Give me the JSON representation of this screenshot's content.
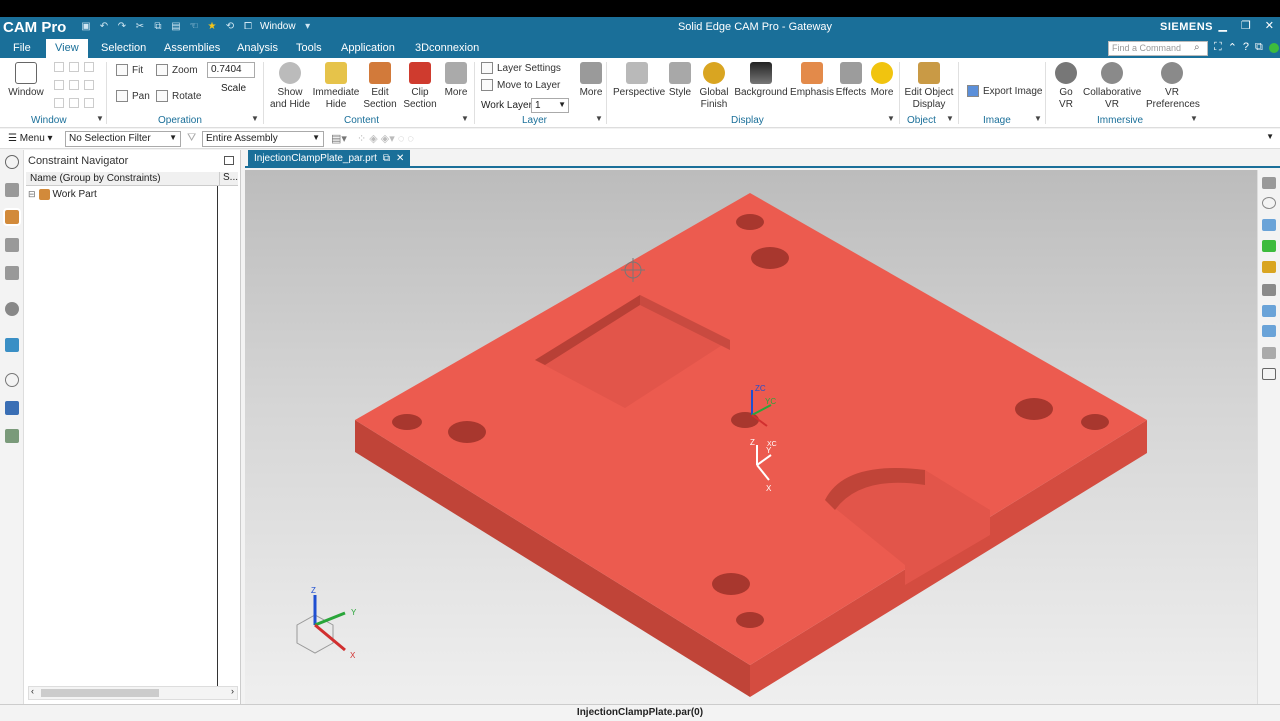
{
  "app": {
    "name": "CAM Pro",
    "window_menu_label": "Window",
    "title": "Solid Edge CAM Pro - Gateway",
    "brand": "SIEMENS",
    "find_placeholder": "Find a Command"
  },
  "menu_tabs": [
    "File",
    "View",
    "Selection",
    "Assemblies",
    "Analysis",
    "Tools",
    "Application",
    "3Dconnexion"
  ],
  "ribbon": {
    "window_group": {
      "button": "Window",
      "label": "Window"
    },
    "operation": {
      "fit": "Fit",
      "zoom": "Zoom",
      "pan": "Pan",
      "rotate": "Rotate",
      "scale_value": "0.7404",
      "scale_label": "Scale",
      "label": "Operation"
    },
    "content": {
      "show_hide": "Show\nand Hide",
      "immediate_hide": "Immediate\nHide",
      "edit_section": "Edit\nSection",
      "clip_section": "Clip\nSection",
      "more": "More",
      "label": "Content"
    },
    "layer": {
      "layer_settings": "Layer Settings",
      "move_to_layer": "Move to Layer",
      "work_layer_label": "Work Layer",
      "work_layer_value": "1",
      "more": "More",
      "label": "Layer"
    },
    "display": {
      "perspective": "Perspective",
      "style": "Style",
      "global_finish": "Global\nFinish",
      "background": "Background",
      "emphasis": "Emphasis",
      "effects": "Effects",
      "more": "More",
      "label": "Display"
    },
    "object": {
      "edit_object_display": "Edit Object\nDisplay",
      "label": "Object"
    },
    "image": {
      "export_image": "Export Image",
      "label": "Image"
    },
    "immersive": {
      "go_vr": "Go\nVR",
      "collaborative_vr": "Collaborative\nVR",
      "vr_preferences": "VR\nPreferences",
      "label": "Immersive"
    }
  },
  "filterbar": {
    "menu": "Menu",
    "selection_filter": "No Selection Filter",
    "scope": "Entire Assembly"
  },
  "navigator": {
    "title": "Constraint Navigator",
    "col_name": "Name (Group by Constraints)",
    "col_status": "S...",
    "rows": [
      "Work Part"
    ]
  },
  "document": {
    "tab": "InjectionClampPlate_par.prt"
  },
  "status": {
    "text": "InjectionClampPlate.par(0)"
  },
  "triad": {
    "zc": "ZC",
    "yc": "YC",
    "xc": "XC",
    "z": "Z",
    "y": "Y",
    "x": "X"
  },
  "colors": {
    "accent": "#1a6f99",
    "part": "#e95a4e"
  }
}
